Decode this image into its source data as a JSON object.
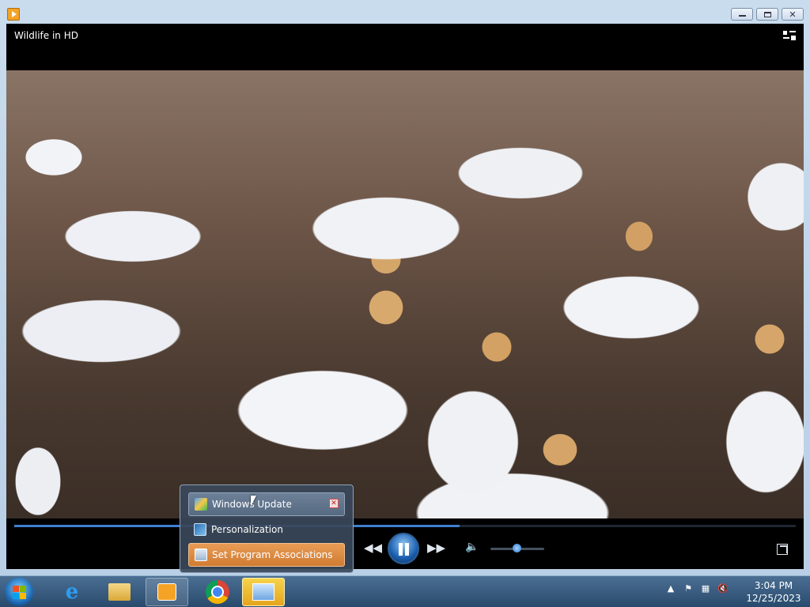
{
  "window": {
    "title": "",
    "buttons": {
      "minimize": "minimize-icon",
      "maximize": "maximize-icon",
      "close": "close-icon"
    }
  },
  "player": {
    "title": "Wildlife in HD",
    "progress_fraction": 0.57,
    "volume_fraction": 0.5
  },
  "popup": {
    "items": [
      {
        "label": "Windows Update",
        "icon": "windows-update-icon"
      },
      {
        "label": "Personalization",
        "icon": "personalization-icon"
      },
      {
        "label": "Set Program Associations",
        "icon": "program-associations-icon"
      }
    ]
  },
  "taskbar": {
    "items": [
      "start-orb",
      "internet-explorer-icon",
      "file-explorer-icon",
      "media-player-icon",
      "chrome-icon",
      "control-panel-icon"
    ]
  },
  "clock": {
    "time": "3:04 PM",
    "date": "12/25/2023"
  },
  "colors": {
    "accent": "#3f7fd0",
    "highlight": "#e08a3e",
    "taskbar": "#284a6d"
  }
}
